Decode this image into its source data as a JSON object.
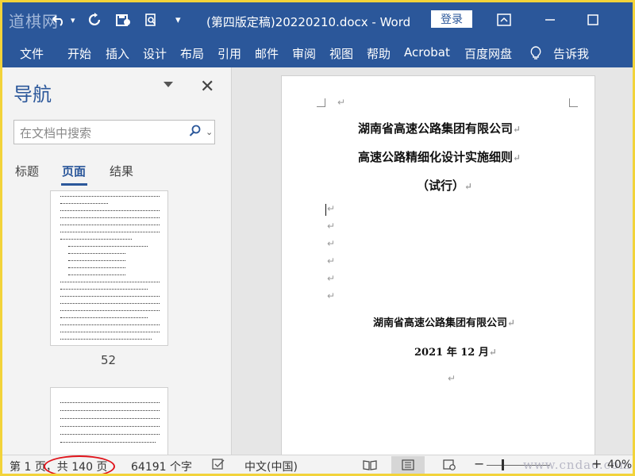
{
  "watermark": "道棋网",
  "titlebar": {
    "document_title": "(第四版定稿)20220210.docx - Word",
    "login_label": "登录"
  },
  "ribbon": {
    "tabs": [
      "文件",
      "开始",
      "插入",
      "设计",
      "布局",
      "引用",
      "邮件",
      "审阅",
      "视图",
      "帮助",
      "Acrobat",
      "百度网盘",
      "告诉我"
    ]
  },
  "nav": {
    "title": "导航",
    "search_placeholder": "在文档中搜索",
    "tabs": [
      "标题",
      "页面",
      "结果"
    ],
    "active_tab": "页面",
    "thumb_page_number": "52"
  },
  "document": {
    "company_header": "湖南省高速公路集团有限公司",
    "doc_title": "高速公路精细化设计实施细则",
    "doc_subtitle": "（试行）",
    "footer_company": "湖南省高速公路集团有限公司",
    "footer_date": "2021 年 12 月",
    "para_mark": "↵"
  },
  "statusbar": {
    "page_info": "第 1 页，共 140 页",
    "word_count": "64191 个字",
    "language": "中文(中国)",
    "zoom": "40%",
    "footer_watermark": "www.cndao.com"
  },
  "colors": {
    "accent": "#2b579a",
    "annotation_oval": "#e0131a",
    "frame_border": "#f2d33a"
  }
}
